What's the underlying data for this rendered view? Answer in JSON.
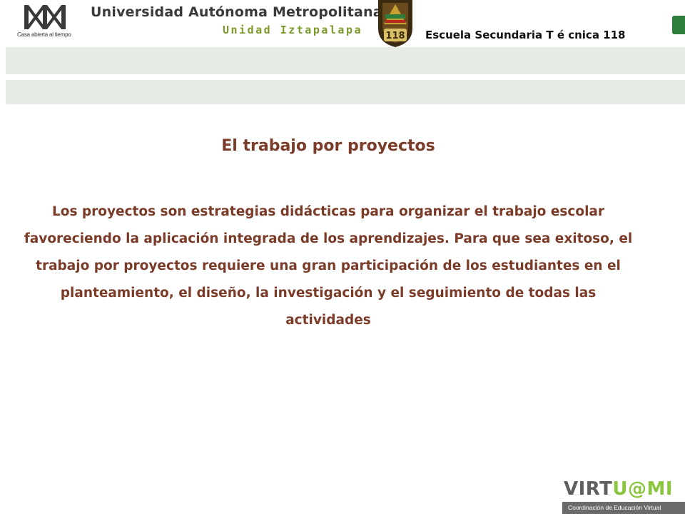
{
  "header": {
    "uam_tagline": "Casa abierta al tiempo",
    "university_name": "Universidad Autónoma Metropolitana",
    "unit_name": "Unidad Iztapalapa",
    "shield_number": "118",
    "school_name": "Escuela Secundaria T é cnica 118"
  },
  "content": {
    "title": "El trabajo por proyectos",
    "paragraph": "Los proyectos son estrategias didácticas para organizar el trabajo escolar favoreciendo la aplicación integrada de los aprendizajes. Para que sea exitoso, el trabajo por proyectos requiere una gran participación de los estudiantes en el planteamiento, el diseño, la investigación y el seguimiento de todas las actividades"
  },
  "footer": {
    "logo_part1": "VIRT",
    "logo_part2": "U@MI",
    "logo_subtitle": "Coordinación de Educación Virtual"
  },
  "colors": {
    "text_brown": "#7a3b28",
    "band_gray": "#e6ebe3",
    "uam_green": "#7b9a2a",
    "virtuami_green": "#8cc63f"
  }
}
